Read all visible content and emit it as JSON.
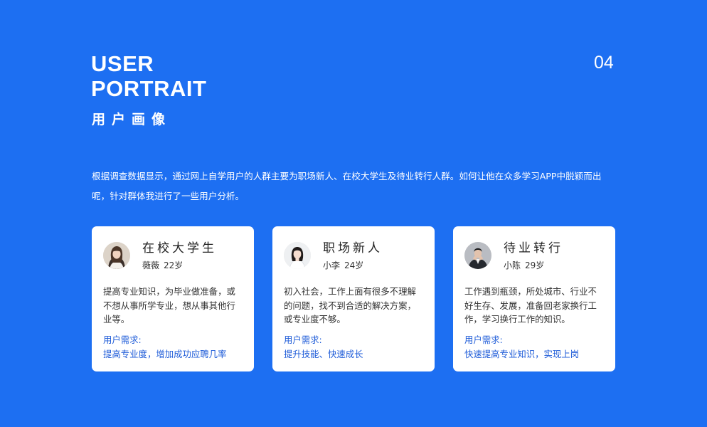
{
  "header": {
    "title_line1": "USER",
    "title_line2": "PORTRAIT",
    "subtitle": "用户画像",
    "page_number": "04"
  },
  "intro": "根据调查数据显示，通过网上自学用户的人群主要为职场新人、在校大学生及待业转行人群。如何让他在众多学习APP中脱颖而出呢，针对群体我进行了一些用户分析。",
  "colors": {
    "background": "#1d6ff2",
    "card": "#ffffff",
    "need_text": "#1d5bd8"
  },
  "cards": [
    {
      "title": "在校大学生",
      "name": "薇薇",
      "age": "22岁",
      "avatar_icon": "female-student-avatar-icon",
      "description": "提高专业知识，为毕业做准备，或不想从事所学专业，想从事其他行业等。",
      "need_label": "用户需求:",
      "need_value": "提高专业度，增加成功应聘几率"
    },
    {
      "title": "职场新人",
      "name": "小李",
      "age": "24岁",
      "avatar_icon": "female-professional-avatar-icon",
      "description": "初入社会，工作上面有很多不理解的问题，找不到合适的解决方案，或专业度不够。",
      "need_label": "用户需求:",
      "need_value": "提升技能、快速成长"
    },
    {
      "title": "待业转行",
      "name": "小陈",
      "age": "29岁",
      "avatar_icon": "male-jobseeker-avatar-icon",
      "description": "工作遇到瓶颈，所处城市、行业不好生存、发展，准备回老家换行工作，学习换行工作的知识。",
      "need_label": "用户需求:",
      "need_value": "快速提高专业知识，实现上岗"
    }
  ]
}
